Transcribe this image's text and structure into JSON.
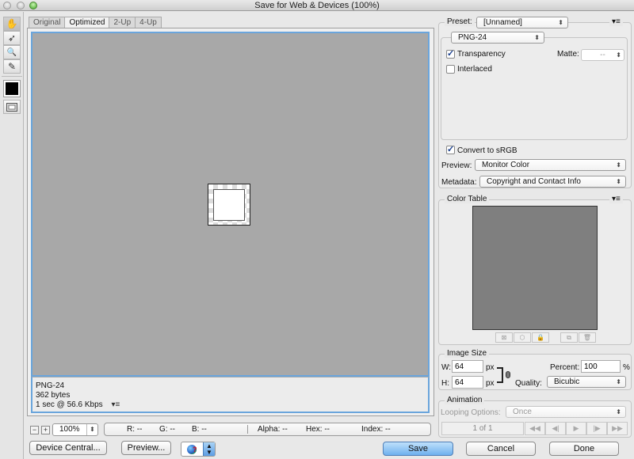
{
  "window": {
    "title": "Save for Web & Devices (100%)"
  },
  "toolbox": {
    "tools": [
      {
        "name": "hand-tool",
        "glyph": "✋"
      },
      {
        "name": "slice-select-tool",
        "glyph": "➶"
      },
      {
        "name": "zoom-tool",
        "glyph": "🔍"
      },
      {
        "name": "eyedropper-tool",
        "glyph": "✎"
      }
    ],
    "color_swatch": "#000000"
  },
  "tabs": [
    {
      "label": "Original",
      "active": false
    },
    {
      "label": "Optimized",
      "active": true
    },
    {
      "label": "2-Up",
      "active": false
    },
    {
      "label": "4-Up",
      "active": false
    }
  ],
  "preview_info": {
    "format": "PNG-24",
    "size": "362 bytes",
    "download_time": "1 sec @ 56.6 Kbps",
    "menu_glyph": "▾≡"
  },
  "status_bar": {
    "zoom_out": "−",
    "zoom_in": "+",
    "zoom_level": "100%",
    "readout": {
      "r": "R: --",
      "g": "G: --",
      "b": "B: --",
      "alpha": "Alpha: --",
      "hex": "Hex: --",
      "index": "Index: --"
    }
  },
  "bottom_buttons": {
    "device_central": "Device Central...",
    "preview": "Preview...",
    "save": "Save",
    "cancel": "Cancel",
    "done": "Done"
  },
  "settings": {
    "preset_label": "Preset:",
    "preset_value": "[Unnamed]",
    "panel_menu_glyph": "▾≡",
    "format_value": "PNG-24",
    "transparency_label": "Transparency",
    "transparency_checked": true,
    "matte_label": "Matte:",
    "matte_value": "--",
    "interlaced_label": "Interlaced",
    "interlaced_checked": false,
    "convert_srgb_label": "Convert to sRGB",
    "convert_srgb_checked": true,
    "preview_label": "Preview:",
    "preview_value": "Monitor Color",
    "metadata_label": "Metadata:",
    "metadata_value": "Copyright and Contact Info"
  },
  "color_table": {
    "title": "Color Table",
    "menu_glyph": "▾≡",
    "color": "#7f7f7f",
    "buttons": [
      {
        "name": "map-transparency-button",
        "glyph": "⊠"
      },
      {
        "name": "web-shift-button",
        "glyph": "⬡"
      },
      {
        "name": "lock-color-button",
        "glyph": "🔒"
      },
      {
        "name": "new-color-button",
        "glyph": "⧉"
      },
      {
        "name": "delete-color-button",
        "glyph": "🗑"
      }
    ]
  },
  "image_size": {
    "title": "Image Size",
    "w_label": "W:",
    "w_value": "64",
    "h_label": "H:",
    "h_value": "64",
    "unit": "px",
    "percent_label": "Percent:",
    "percent_value": "100",
    "percent_unit": "%",
    "quality_label": "Quality:",
    "quality_value": "Bicubic"
  },
  "animation": {
    "title": "Animation",
    "looping_label": "Looping Options:",
    "looping_value": "Once",
    "frame_counter": "1 of 1",
    "controls": [
      "◀◀",
      "◀|",
      "▶",
      "|▶",
      "▶▶"
    ]
  }
}
